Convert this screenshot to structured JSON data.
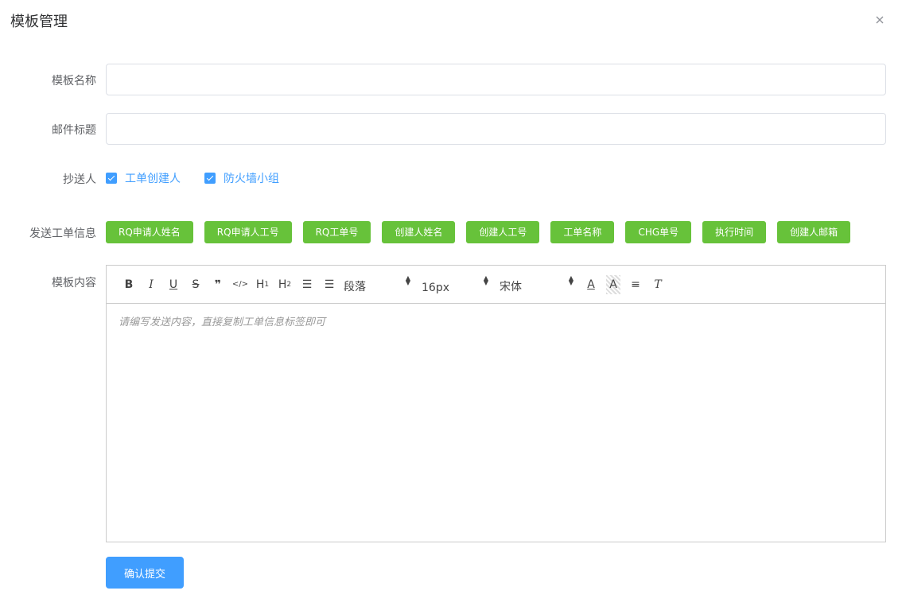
{
  "dialog": {
    "title": "模板管理",
    "close_icon": "close-icon"
  },
  "form": {
    "template_name": {
      "label": "模板名称",
      "value": "",
      "placeholder": ""
    },
    "mail_subject": {
      "label": "邮件标题",
      "value": "",
      "placeholder": ""
    },
    "cc": {
      "label": "抄送人",
      "options": [
        {
          "label": "工单创建人",
          "checked": true
        },
        {
          "label": "防火墙小组",
          "checked": true
        }
      ]
    },
    "ticket_info": {
      "label": "发送工单信息",
      "tags": [
        "RQ申请人姓名",
        "RQ申请人工号",
        "RQ工单号",
        "创建人姓名",
        "创建人工号",
        "工单名称",
        "CHG单号",
        "执行时间",
        "创建人邮箱"
      ]
    },
    "content": {
      "label": "模板内容",
      "placeholder": "请编写发送内容，直接复制工单信息标签即可",
      "toolbar": {
        "bold": "B",
        "italic": "I",
        "underline": "U",
        "strike": "S",
        "quote": "❞",
        "code": "</>",
        "h1": "H",
        "h1_sub": "1",
        "h2": "H",
        "h2_sub": "2",
        "ordered_list": "☰",
        "bullet_list": "☰",
        "paragraph": "段落",
        "font_size": "16px",
        "font_family": "宋体",
        "font_color": "A",
        "background": "A",
        "align": "≡",
        "clear": "T"
      }
    },
    "submit_label": "确认提交"
  },
  "colors": {
    "primary": "#409eff",
    "success": "#67c23a",
    "border": "#dcdfe6"
  }
}
